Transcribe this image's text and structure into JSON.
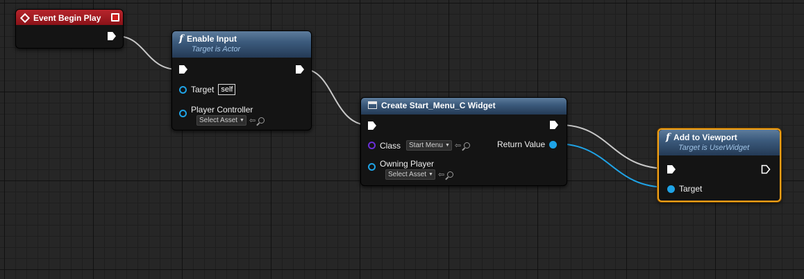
{
  "nodes": {
    "event_begin_play": {
      "title": "Event Begin Play"
    },
    "enable_input": {
      "title": "Enable Input",
      "subtitle": "Target is Actor",
      "target_label": "Target",
      "target_value": "self",
      "player_controller_label": "Player Controller",
      "player_controller_value": "Select Asset"
    },
    "create_widget": {
      "title": "Create Start_Menu_C Widget",
      "class_label": "Class",
      "class_value": "Start Menu",
      "owning_player_label": "Owning Player",
      "owning_player_value": "Select Asset",
      "return_value_label": "Return Value"
    },
    "add_to_viewport": {
      "title": "Add to Viewport",
      "subtitle": "Target is UserWidget",
      "target_label": "Target"
    }
  },
  "colors": {
    "exec_wire": "#c8c8c8",
    "object_wire": "#1fa3e6",
    "event_header": "#a81c22",
    "function_header": "#3c5b7d",
    "selection": "#f0a018"
  },
  "icons": {
    "function": "f",
    "event": "diamond-icon",
    "widget": "widget-icon",
    "reset": "arrow-left-icon",
    "browse": "magnifier-icon"
  }
}
